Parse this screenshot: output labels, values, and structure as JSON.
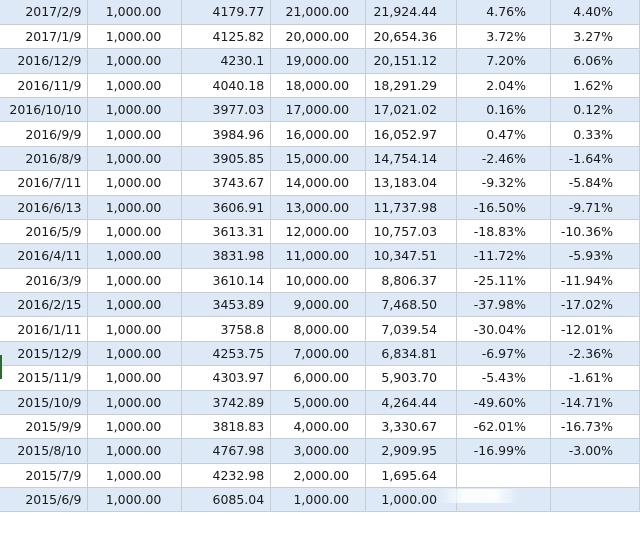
{
  "table": {
    "rows": [
      {
        "date": "2017/2/9",
        "invest": "1,000.00",
        "price": "4179.77",
        "principal": "21,000.00",
        "value": "21,924.44",
        "return": "4.76%",
        "pct": "4.40%"
      },
      {
        "date": "2017/1/9",
        "invest": "1,000.00",
        "price": "4125.82",
        "principal": "20,000.00",
        "value": "20,654.36",
        "return": "3.72%",
        "pct": "3.27%"
      },
      {
        "date": "2016/12/9",
        "invest": "1,000.00",
        "price": "4230.1",
        "principal": "19,000.00",
        "value": "20,151.12",
        "return": "7.20%",
        "pct": "6.06%"
      },
      {
        "date": "2016/11/9",
        "invest": "1,000.00",
        "price": "4040.18",
        "principal": "18,000.00",
        "value": "18,291.29",
        "return": "2.04%",
        "pct": "1.62%"
      },
      {
        "date": "2016/10/10",
        "invest": "1,000.00",
        "price": "3977.03",
        "principal": "17,000.00",
        "value": "17,021.02",
        "return": "0.16%",
        "pct": "0.12%"
      },
      {
        "date": "2016/9/9",
        "invest": "1,000.00",
        "price": "3984.96",
        "principal": "16,000.00",
        "value": "16,052.97",
        "return": "0.47%",
        "pct": "0.33%"
      },
      {
        "date": "2016/8/9",
        "invest": "1,000.00",
        "price": "3905.85",
        "principal": "15,000.00",
        "value": "14,754.14",
        "return": "-2.46%",
        "pct": "-1.64%"
      },
      {
        "date": "2016/7/11",
        "invest": "1,000.00",
        "price": "3743.67",
        "principal": "14,000.00",
        "value": "13,183.04",
        "return": "-9.32%",
        "pct": "-5.84%"
      },
      {
        "date": "2016/6/13",
        "invest": "1,000.00",
        "price": "3606.91",
        "principal": "13,000.00",
        "value": "11,737.98",
        "return": "-16.50%",
        "pct": "-9.71%"
      },
      {
        "date": "2016/5/9",
        "invest": "1,000.00",
        "price": "3613.31",
        "principal": "12,000.00",
        "value": "10,757.03",
        "return": "-18.83%",
        "pct": "-10.36%"
      },
      {
        "date": "2016/4/11",
        "invest": "1,000.00",
        "price": "3831.98",
        "principal": "11,000.00",
        "value": "10,347.51",
        "return": "-11.72%",
        "pct": "-5.93%"
      },
      {
        "date": "2016/3/9",
        "invest": "1,000.00",
        "price": "3610.14",
        "principal": "10,000.00",
        "value": "8,806.37",
        "return": "-25.11%",
        "pct": "-11.94%"
      },
      {
        "date": "2016/2/15",
        "invest": "1,000.00",
        "price": "3453.89",
        "principal": "9,000.00",
        "value": "7,468.50",
        "return": "-37.98%",
        "pct": "-17.02%"
      },
      {
        "date": "2016/1/11",
        "invest": "1,000.00",
        "price": "3758.8",
        "principal": "8,000.00",
        "value": "7,039.54",
        "return": "-30.04%",
        "pct": "-12.01%"
      },
      {
        "date": "2015/12/9",
        "invest": "1,000.00",
        "price": "4253.75",
        "principal": "7,000.00",
        "value": "6,834.81",
        "return": "-6.97%",
        "pct": "-2.36%"
      },
      {
        "date": "2015/11/9",
        "invest": "1,000.00",
        "price": "4303.97",
        "principal": "6,000.00",
        "value": "5,903.70",
        "return": "-5.43%",
        "pct": "-1.61%"
      },
      {
        "date": "2015/10/9",
        "invest": "1,000.00",
        "price": "3742.89",
        "principal": "5,000.00",
        "value": "4,264.44",
        "return": "-49.60%",
        "pct": "-14.71%"
      },
      {
        "date": "2015/9/9",
        "invest": "1,000.00",
        "price": "3818.83",
        "principal": "4,000.00",
        "value": "3,330.67",
        "return": "-62.01%",
        "pct": "-16.73%"
      },
      {
        "date": "2015/8/10",
        "invest": "1,000.00",
        "price": "4767.98",
        "principal": "3,000.00",
        "value": "2,909.95",
        "return": "-16.99%",
        "pct": "-3.00%"
      },
      {
        "date": "2015/7/9",
        "invest": "1,000.00",
        "price": "4232.98",
        "principal": "2,000.00",
        "value": "1,695.64",
        "return": "",
        "pct": ""
      },
      {
        "date": "2015/6/9",
        "invest": "1,000.00",
        "price": "6085.04",
        "principal": "1,000.00",
        "value": "1,000.00",
        "return": "",
        "pct": ""
      }
    ]
  },
  "colors": {
    "row_shaded": "#dde9f6",
    "row_plain": "#ffffff",
    "grid_line": "#c8cdd4",
    "text": "#1a1a1a",
    "active_row_marker": "#2d6a2d"
  }
}
